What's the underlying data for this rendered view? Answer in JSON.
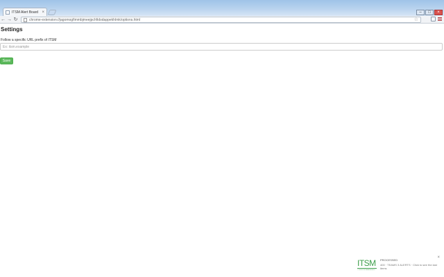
{
  "browser": {
    "tab_title": "ITSM Alert Board",
    "tab_close_glyph": "×",
    "url": "chrome-extension://jagomogfimmbjmeejpchfidodappekhlmk/options.html",
    "window_controls": {
      "minimize": "–",
      "maximize": "□",
      "close": "×"
    },
    "nav": {
      "back": "←",
      "forward": "→",
      "reload": "↻"
    },
    "bookmark_glyph": "☆"
  },
  "page": {
    "title": "Settings",
    "url_field": {
      "label": "Follow a specific URL prefix of ITSM",
      "value": "",
      "placeholder": "Ex: itsm.example"
    },
    "save_label": "Save"
  },
  "widget": {
    "close_glyph": "×",
    "logo_text": "ITSM",
    "logo_tag": "IT SERVICE MANAGEMENT",
    "title": "PROCESSED",
    "message": "400 · TEAMS 3 ALERTS · Click to see the last items"
  },
  "colors": {
    "accent_green": "#5cb85c",
    "logo_green": "#3d9e4a",
    "close_red": "#d9534f"
  }
}
